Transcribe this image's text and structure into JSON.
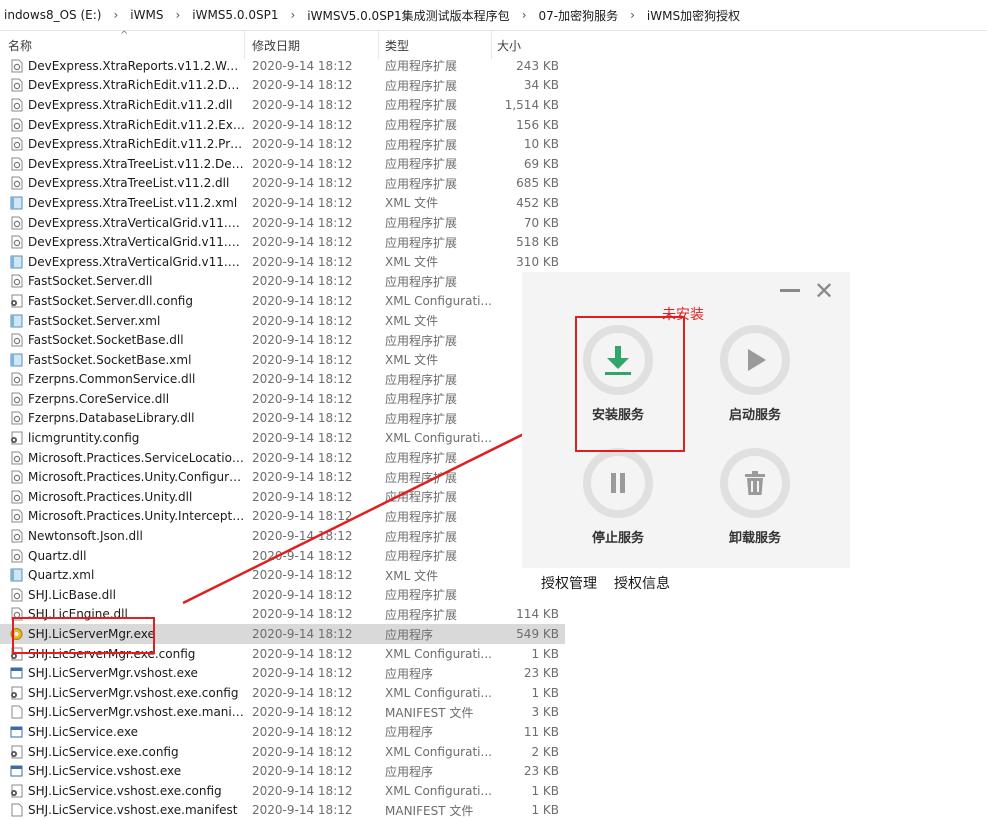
{
  "breadcrumb": [
    "indows8_OS (E:)",
    "iWMS",
    "iWMS5.0.0SP1",
    "iWMSV5.0.0SP1集成测试版本程序包",
    "07-加密狗服务",
    "iWMS加密狗授权"
  ],
  "columns": {
    "name": "名称",
    "date": "修改日期",
    "type": "类型",
    "size": "大小"
  },
  "files": [
    {
      "name": "DevExpress.XtraReports.v11.2.Web.dll",
      "date": "2020-9-14 18:12",
      "type": "应用程序扩展",
      "size": "243 KB",
      "icon": "dll"
    },
    {
      "name": "DevExpress.XtraRichEdit.v11.2.Design...",
      "date": "2020-9-14 18:12",
      "type": "应用程序扩展",
      "size": "34 KB",
      "icon": "dll"
    },
    {
      "name": "DevExpress.XtraRichEdit.v11.2.dll",
      "date": "2020-9-14 18:12",
      "type": "应用程序扩展",
      "size": "1,514 KB",
      "icon": "dll"
    },
    {
      "name": "DevExpress.XtraRichEdit.v11.2.Extensi...",
      "date": "2020-9-14 18:12",
      "type": "应用程序扩展",
      "size": "156 KB",
      "icon": "dll"
    },
    {
      "name": "DevExpress.XtraRichEdit.v11.2.Printin...",
      "date": "2020-9-14 18:12",
      "type": "应用程序扩展",
      "size": "10 KB",
      "icon": "dll"
    },
    {
      "name": "DevExpress.XtraTreeList.v11.2.Design...",
      "date": "2020-9-14 18:12",
      "type": "应用程序扩展",
      "size": "69 KB",
      "icon": "dll"
    },
    {
      "name": "DevExpress.XtraTreeList.v11.2.dll",
      "date": "2020-9-14 18:12",
      "type": "应用程序扩展",
      "size": "685 KB",
      "icon": "dll"
    },
    {
      "name": "DevExpress.XtraTreeList.v11.2.xml",
      "date": "2020-9-14 18:12",
      "type": "XML 文件",
      "size": "452 KB",
      "icon": "xml"
    },
    {
      "name": "DevExpress.XtraVerticalGrid.v11.2.De...",
      "date": "2020-9-14 18:12",
      "type": "应用程序扩展",
      "size": "70 KB",
      "icon": "dll"
    },
    {
      "name": "DevExpress.XtraVerticalGrid.v11.2.dll",
      "date": "2020-9-14 18:12",
      "type": "应用程序扩展",
      "size": "518 KB",
      "icon": "dll"
    },
    {
      "name": "DevExpress.XtraVerticalGrid.v11.2.xml",
      "date": "2020-9-14 18:12",
      "type": "XML 文件",
      "size": "310 KB",
      "icon": "xml"
    },
    {
      "name": "FastSocket.Server.dll",
      "date": "2020-9-14 18:12",
      "type": "应用程序扩展",
      "size": "",
      "icon": "dll"
    },
    {
      "name": "FastSocket.Server.dll.config",
      "date": "2020-9-14 18:12",
      "type": "XML Configurati...",
      "size": "",
      "icon": "config"
    },
    {
      "name": "FastSocket.Server.xml",
      "date": "2020-9-14 18:12",
      "type": "XML 文件",
      "size": "",
      "icon": "xml"
    },
    {
      "name": "FastSocket.SocketBase.dll",
      "date": "2020-9-14 18:12",
      "type": "应用程序扩展",
      "size": "",
      "icon": "dll"
    },
    {
      "name": "FastSocket.SocketBase.xml",
      "date": "2020-9-14 18:12",
      "type": "XML 文件",
      "size": "",
      "icon": "xml"
    },
    {
      "name": "Fzerpns.CommonService.dll",
      "date": "2020-9-14 18:12",
      "type": "应用程序扩展",
      "size": "",
      "icon": "dll"
    },
    {
      "name": "Fzerpns.CoreService.dll",
      "date": "2020-9-14 18:12",
      "type": "应用程序扩展",
      "size": "",
      "icon": "dll"
    },
    {
      "name": "Fzerpns.DatabaseLibrary.dll",
      "date": "2020-9-14 18:12",
      "type": "应用程序扩展",
      "size": "",
      "icon": "dll"
    },
    {
      "name": "licmgruntity.config",
      "date": "2020-9-14 18:12",
      "type": "XML Configurati...",
      "size": "",
      "icon": "config"
    },
    {
      "name": "Microsoft.Practices.ServiceLocation.dll",
      "date": "2020-9-14 18:12",
      "type": "应用程序扩展",
      "size": "",
      "icon": "dll"
    },
    {
      "name": "Microsoft.Practices.Unity.Configuratio...",
      "date": "2020-9-14 18:12",
      "type": "应用程序扩展",
      "size": "",
      "icon": "dll"
    },
    {
      "name": "Microsoft.Practices.Unity.dll",
      "date": "2020-9-14 18:12",
      "type": "应用程序扩展",
      "size": "",
      "icon": "dll"
    },
    {
      "name": "Microsoft.Practices.Unity.Interception...",
      "date": "2020-9-14 18:12",
      "type": "应用程序扩展",
      "size": "",
      "icon": "dll"
    },
    {
      "name": "Newtonsoft.Json.dll",
      "date": "2020-9-14 18:12",
      "type": "应用程序扩展",
      "size": "",
      "icon": "dll"
    },
    {
      "name": "Quartz.dll",
      "date": "2020-9-14 18:12",
      "type": "应用程序扩展",
      "size": "",
      "icon": "dll"
    },
    {
      "name": "Quartz.xml",
      "date": "2020-9-14 18:12",
      "type": "XML 文件",
      "size": "1,",
      "icon": "xml"
    },
    {
      "name": "SHJ.LicBase.dll",
      "date": "2020-9-14 18:12",
      "type": "应用程序扩展",
      "size": "",
      "icon": "dll"
    },
    {
      "name": "SHJ.LicEngine.dll",
      "date": "2020-9-14 18:12",
      "type": "应用程序扩展",
      "size": "114 KB",
      "icon": "dll"
    },
    {
      "name": "SHJ.LicServerMgr.exe",
      "date": "2020-9-14 18:12",
      "type": "应用程序",
      "size": "549 KB",
      "icon": "app",
      "selected": true
    },
    {
      "name": "SHJ.LicServerMgr.exe.config",
      "date": "2020-9-14 18:12",
      "type": "XML Configurati...",
      "size": "1 KB",
      "icon": "config"
    },
    {
      "name": "SHJ.LicServerMgr.vshost.exe",
      "date": "2020-9-14 18:12",
      "type": "应用程序",
      "size": "23 KB",
      "icon": "exe"
    },
    {
      "name": "SHJ.LicServerMgr.vshost.exe.config",
      "date": "2020-9-14 18:12",
      "type": "XML Configurati...",
      "size": "1 KB",
      "icon": "config"
    },
    {
      "name": "SHJ.LicServerMgr.vshost.exe.manifest",
      "date": "2020-9-14 18:12",
      "type": "MANIFEST 文件",
      "size": "3 KB",
      "icon": "blank"
    },
    {
      "name": "SHJ.LicService.exe",
      "date": "2020-9-14 18:12",
      "type": "应用程序",
      "size": "11 KB",
      "icon": "exe"
    },
    {
      "name": "SHJ.LicService.exe.config",
      "date": "2020-9-14 18:12",
      "type": "XML Configurati...",
      "size": "2 KB",
      "icon": "config"
    },
    {
      "name": "SHJ.LicService.vshost.exe",
      "date": "2020-9-14 18:12",
      "type": "应用程序",
      "size": "23 KB",
      "icon": "exe"
    },
    {
      "name": "SHJ.LicService.vshost.exe.config",
      "date": "2020-9-14 18:12",
      "type": "XML Configurati...",
      "size": "1 KB",
      "icon": "config"
    },
    {
      "name": "SHJ.LicService.vshost.exe.manifest",
      "date": "2020-9-14 18:12",
      "type": "MANIFEST 文件",
      "size": "1 KB",
      "icon": "blank"
    }
  ],
  "dialog": {
    "status": "未安装",
    "install": "安装服务",
    "start": "启动服务",
    "stop": "停止服务",
    "uninstall": "卸载服务",
    "tab_manage": "授权管理",
    "tab_info": "授权信息",
    "colors": {
      "accent": "#2fa66a",
      "status": "#e02020",
      "icon_gray": "#9a9a9a"
    }
  }
}
